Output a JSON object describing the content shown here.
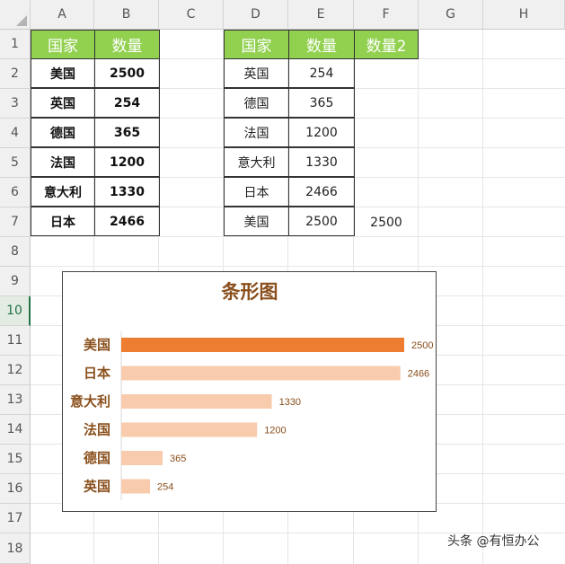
{
  "column_headers": [
    "A",
    "B",
    "C",
    "D",
    "E",
    "F",
    "G",
    "H"
  ],
  "row_headers": [
    "1",
    "2",
    "3",
    "4",
    "5",
    "6",
    "7",
    "8",
    "9",
    "10",
    "11",
    "12",
    "13",
    "14",
    "15",
    "16",
    "17",
    "18"
  ],
  "table1": {
    "headers": [
      "国家",
      "数量"
    ],
    "rows": [
      [
        "美国",
        "2500"
      ],
      [
        "英国",
        "254"
      ],
      [
        "德国",
        "365"
      ],
      [
        "法国",
        "1200"
      ],
      [
        "意大利",
        "1330"
      ],
      [
        "日本",
        "2466"
      ]
    ]
  },
  "table2": {
    "headers": [
      "国家",
      "数量",
      "数量2"
    ],
    "rows": [
      [
        "英国",
        "254"
      ],
      [
        "德国",
        "365"
      ],
      [
        "法国",
        "1200"
      ],
      [
        "意大利",
        "1330"
      ],
      [
        "日本",
        "2466"
      ],
      [
        "美国",
        "2500"
      ]
    ],
    "f7": "2500"
  },
  "chart_data": {
    "type": "bar",
    "orientation": "horizontal",
    "title": "条形图",
    "categories": [
      "美国",
      "日本",
      "意大利",
      "法国",
      "德国",
      "英国"
    ],
    "values": [
      2500,
      2466,
      1330,
      1200,
      365,
      254
    ],
    "xlim": [
      0,
      2750
    ],
    "highlight_color": "#ed7d31",
    "base_color": "#f8cbad",
    "label_color": "#8a4f1c"
  },
  "watermark": "头条 @有恒办公"
}
